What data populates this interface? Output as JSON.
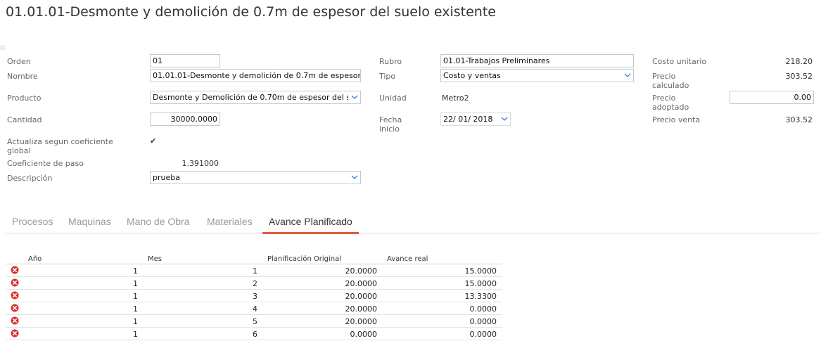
{
  "title": "01.01.01-Desmonte y demolición de 0.7m de espesor del suelo existente",
  "form": {
    "orden_label": "Orden",
    "orden_value": "01",
    "nombre_label": "Nombre",
    "nombre_value": "01.01.01-Desmonte y demolición de 0.7m de espesor",
    "producto_label": "Producto",
    "producto_value": "Desmonte y Demolición de 0.70m de espesor del s",
    "cantidad_label": "Cantidad",
    "cantidad_value": "30000.0000",
    "actualiza_label": "Actualiza segun coeficiente global",
    "actualiza_checked": "✔",
    "coef_label": "Coeficiente de paso",
    "coef_value": "1.391000",
    "descripcion_label": "Descripción",
    "descripcion_value": "prueba",
    "rubro_label": "Rubro",
    "rubro_value": "01.01-Trabajos Preliminares",
    "tipo_label": "Tipo",
    "tipo_value": "Costo y ventas",
    "unidad_label": "Unidad",
    "unidad_value": "Metro2",
    "fecha_label": "Fecha inicio",
    "fecha_value": "22/ 01/ 2018",
    "costo_unitario_label": "Costo unitario",
    "costo_unitario_value": "218.20",
    "precio_calculado_label": "Precio calculado",
    "precio_calculado_value": "303.52",
    "precio_adoptado_label": "Precio adoptado",
    "precio_adoptado_value": "0.00",
    "precio_venta_label": "Precio venta",
    "precio_venta_value": "303.52"
  },
  "tabs": [
    {
      "label": "Procesos",
      "active": false
    },
    {
      "label": "Maquinas",
      "active": false
    },
    {
      "label": "Mano de Obra",
      "active": false
    },
    {
      "label": "Materiales",
      "active": false
    },
    {
      "label": "Avance Planificado",
      "active": true
    }
  ],
  "grid": {
    "columns": [
      "Año",
      "Mes",
      "Planificación Original",
      "Avance real"
    ],
    "rows": [
      {
        "anio": "1",
        "mes": "1",
        "planificacion": "20.0000",
        "avance": "15.0000"
      },
      {
        "anio": "1",
        "mes": "2",
        "planificacion": "20.0000",
        "avance": "15.0000"
      },
      {
        "anio": "1",
        "mes": "3",
        "planificacion": "20.0000",
        "avance": "13.3300"
      },
      {
        "anio": "1",
        "mes": "4",
        "planificacion": "20.0000",
        "avance": "0.0000"
      },
      {
        "anio": "1",
        "mes": "5",
        "planificacion": "20.0000",
        "avance": "0.0000"
      },
      {
        "anio": "1",
        "mes": "6",
        "planificacion": "0.0000",
        "avance": "0.0000"
      }
    ]
  },
  "colors": {
    "accent_tab": "#e35a3b",
    "chevron": "#3d7fc1",
    "delete_icon": "#d9302b"
  },
  "icons": {
    "dropdown": "chevron-down-icon",
    "delete": "delete-circle-x-icon",
    "checkbox": "checkmark-icon"
  }
}
